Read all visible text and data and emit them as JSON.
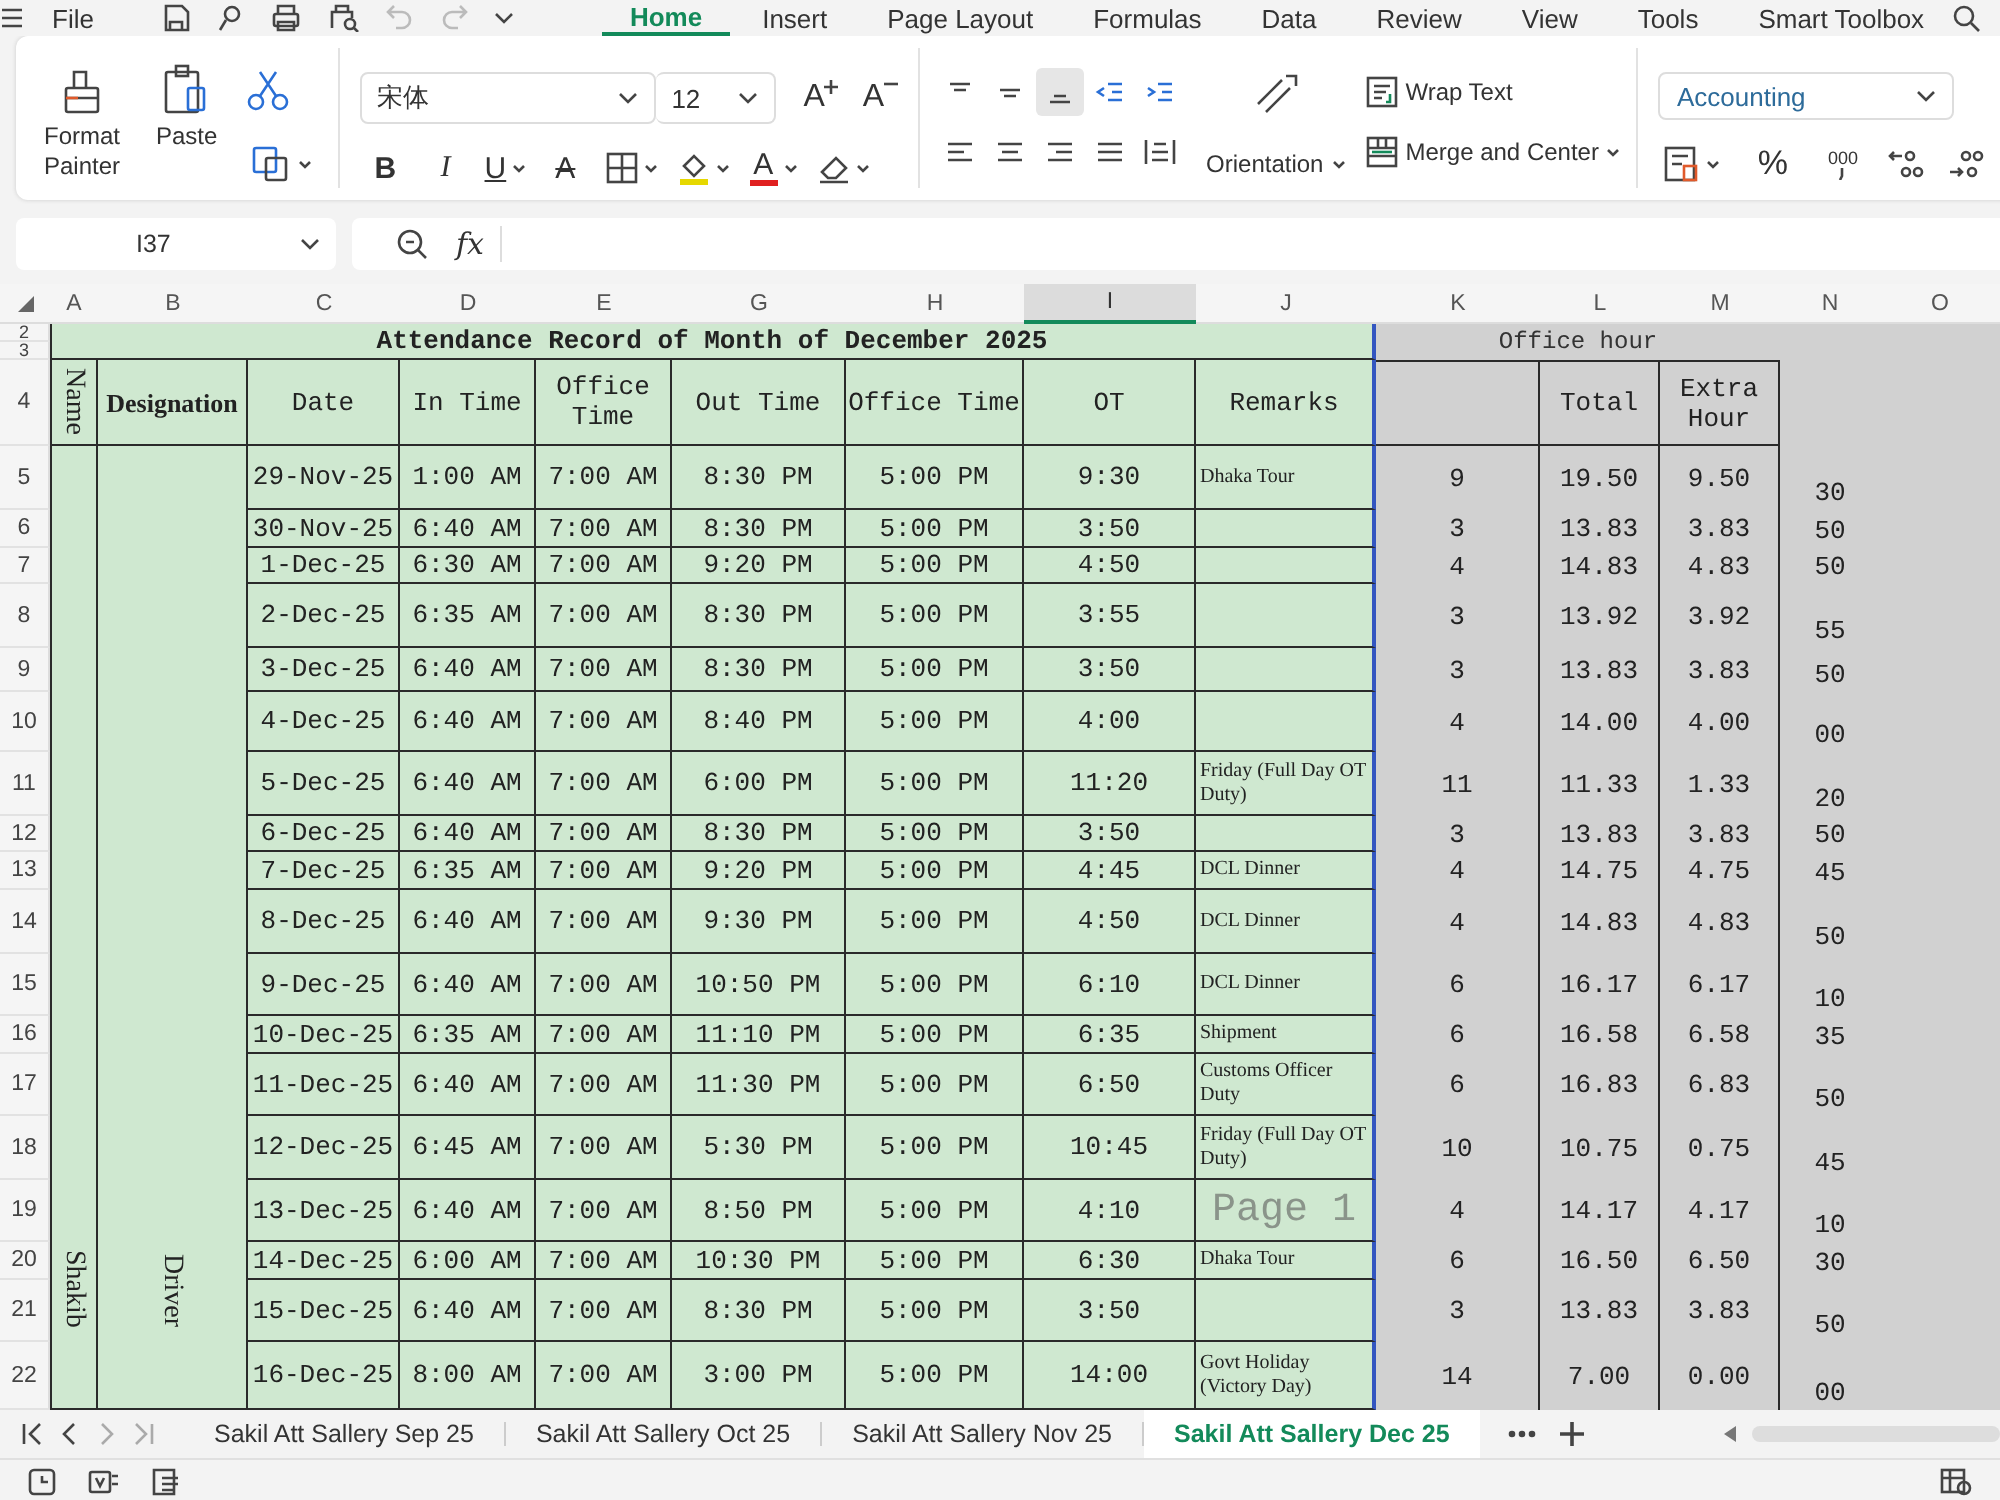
{
  "menu_bar": {
    "file": "File",
    "tabs": [
      {
        "label": "Home",
        "selected": true
      },
      {
        "label": "Insert",
        "selected": false
      },
      {
        "label": "Page Layout",
        "selected": false
      },
      {
        "label": "Formulas",
        "selected": false
      },
      {
        "label": "Data",
        "selected": false
      },
      {
        "label": "Review",
        "selected": false
      },
      {
        "label": "View",
        "selected": false
      },
      {
        "label": "Tools",
        "selected": false
      },
      {
        "label": "Smart Toolbox",
        "selected": false
      }
    ]
  },
  "ribbon": {
    "format_painter": "Format Painter",
    "paste": "Paste",
    "font_name": "宋体",
    "font_size": "12",
    "grow_font": "A",
    "shrink_font": "A",
    "text_buttons": [
      {
        "kind": "bold",
        "label": "B"
      },
      {
        "kind": "italic",
        "label": "I"
      },
      {
        "kind": "underline",
        "label": "U"
      },
      {
        "kind": "strikethrough",
        "label": "A"
      }
    ],
    "font_color": "A",
    "alignment_buttons": [
      {
        "kind": "top",
        "selected": false
      },
      {
        "kind": "middle",
        "selected": false
      },
      {
        "kind": "bottom",
        "selected": true
      },
      {
        "kind": "outdent",
        "selected": false
      },
      {
        "kind": "indent",
        "selected": false
      },
      {
        "kind": "left",
        "selected": false
      },
      {
        "kind": "center",
        "selected": false
      },
      {
        "kind": "right",
        "selected": false
      },
      {
        "kind": "justify",
        "selected": false
      },
      {
        "kind": "distributed",
        "selected": false
      }
    ],
    "orientation": "Orientation",
    "wrap_text": "Wrap Text",
    "merge_center": "Merge and Center",
    "number_format": "Accounting",
    "percent_style": "%",
    "comma_style": "000"
  },
  "formula_bar": {
    "cell_reference": "I37",
    "function_label": "fx"
  },
  "sheet": {
    "column_headers": [
      {
        "label": "A",
        "selected": false
      },
      {
        "label": "B",
        "selected": false
      },
      {
        "label": "C",
        "selected": false
      },
      {
        "label": "D",
        "selected": false
      },
      {
        "label": "E",
        "selected": false
      },
      {
        "label": "G",
        "selected": false
      },
      {
        "label": "H",
        "selected": false
      },
      {
        "label": "I",
        "selected": true
      },
      {
        "label": "J",
        "selected": false
      },
      {
        "label": "K",
        "selected": false
      },
      {
        "label": "L",
        "selected": false
      },
      {
        "label": "M",
        "selected": false
      },
      {
        "label": "N",
        "selected": false
      },
      {
        "label": "O",
        "selected": false
      }
    ],
    "header_row_numbers": [
      "2",
      "3",
      "4"
    ],
    "title": "Attendance Record of Month of  December 2025",
    "office_hour_title": "Office hour",
    "headers": [
      "Name",
      "Designation",
      "Date",
      "In Time",
      "Office Time",
      "Out Time",
      "Office Time",
      "OT",
      "Remarks"
    ],
    "summary_headers": [
      "Total",
      "Extra Hour"
    ],
    "name": "Shakib",
    "designation": "Driver",
    "rows": [
      {
        "row": "5",
        "date": "29-Nov-25",
        "in_time": "1:00 AM",
        "office_start": "7:00 AM",
        "out_time": "8:30 PM",
        "office_time": "5:00 PM",
        "ot": "9:30",
        "remarks": "Dhaka Tour",
        "column_k": "9",
        "total": "19.50",
        "extra_hour": "9.50",
        "column_n": "30"
      },
      {
        "row": "6",
        "date": "30-Nov-25",
        "in_time": "6:40 AM",
        "office_start": "7:00 AM",
        "out_time": "8:30 PM",
        "office_time": "5:00 PM",
        "ot": "3:50",
        "column_k": "3",
        "total": "13.83",
        "extra_hour": "3.83",
        "column_n": "50"
      },
      {
        "row": "7",
        "date": "1-Dec-25",
        "in_time": "6:30 AM",
        "office_start": "7:00 AM",
        "out_time": "9:20 PM",
        "office_time": "5:00 PM",
        "ot": "4:50",
        "column_k": "4",
        "total": "14.83",
        "extra_hour": "4.83",
        "column_n": "50"
      },
      {
        "row": "8",
        "date": "2-Dec-25",
        "in_time": "6:35 AM",
        "office_start": "7:00 AM",
        "out_time": "8:30 PM",
        "office_time": "5:00 PM",
        "ot": "3:55",
        "column_k": "3",
        "total": "13.92",
        "extra_hour": "3.92",
        "column_n": "55"
      },
      {
        "row": "9",
        "date": "3-Dec-25",
        "in_time": "6:40 AM",
        "office_start": "7:00 AM",
        "out_time": "8:30 PM",
        "office_time": "5:00 PM",
        "ot": "3:50",
        "column_k": "3",
        "total": "13.83",
        "extra_hour": "3.83",
        "column_n": "50"
      },
      {
        "row": "10",
        "date": "4-Dec-25",
        "in_time": "6:40 AM",
        "office_start": "7:00 AM",
        "out_time": "8:40 PM",
        "office_time": "5:00 PM",
        "ot": "4:00",
        "column_k": "4",
        "total": "14.00",
        "extra_hour": "4.00",
        "column_n": "00"
      },
      {
        "row": "11",
        "date": "5-Dec-25",
        "in_time": "6:40 AM",
        "office_start": "7:00 AM",
        "out_time": "6:00 PM",
        "office_time": "5:00 PM",
        "ot": "11:20",
        "remarks": "Friday (Full Day OT Duty)",
        "column_k": "11",
        "total": "11.33",
        "extra_hour": "1.33",
        "column_n": "20"
      },
      {
        "row": "12",
        "date": "6-Dec-25",
        "in_time": "6:40 AM",
        "office_start": "7:00 AM",
        "out_time": "8:30 PM",
        "office_time": "5:00 PM",
        "ot": "3:50",
        "column_k": "3",
        "total": "13.83",
        "extra_hour": "3.83",
        "column_n": "50"
      },
      {
        "row": "13",
        "date": "7-Dec-25",
        "in_time": "6:35 AM",
        "office_start": "7:00 AM",
        "out_time": "9:20 PM",
        "office_time": "5:00 PM",
        "ot": "4:45",
        "remarks": "DCL Dinner",
        "column_k": "4",
        "total": "14.75",
        "extra_hour": "4.75",
        "column_n": "45"
      },
      {
        "row": "14",
        "date": "8-Dec-25",
        "in_time": "6:40 AM",
        "office_start": "7:00 AM",
        "out_time": "9:30 PM",
        "office_time": "5:00 PM",
        "ot": "4:50",
        "remarks": "DCL Dinner",
        "column_k": "4",
        "total": "14.83",
        "extra_hour": "4.83",
        "column_n": "50"
      },
      {
        "row": "15",
        "date": "9-Dec-25",
        "in_time": "6:40 AM",
        "office_start": "7:00 AM",
        "out_time": "10:50 PM",
        "office_time": "5:00 PM",
        "ot": "6:10",
        "remarks": "DCL Dinner",
        "column_k": "6",
        "total": "16.17",
        "extra_hour": "6.17",
        "column_n": "10"
      },
      {
        "row": "16",
        "date": "10-Dec-25",
        "in_time": "6:35 AM",
        "office_start": "7:00 AM",
        "out_time": "11:10 PM",
        "office_time": "5:00 PM",
        "ot": "6:35",
        "remarks": "Shipment",
        "column_k": "6",
        "total": "16.58",
        "extra_hour": "6.58",
        "column_n": "35"
      },
      {
        "row": "17",
        "date": "11-Dec-25",
        "in_time": "6:40 AM",
        "office_start": "7:00 AM",
        "out_time": "11:30 PM",
        "office_time": "5:00 PM",
        "ot": "6:50",
        "remarks": "Customs Officer Duty",
        "column_k": "6",
        "total": "16.83",
        "extra_hour": "6.83",
        "column_n": "50"
      },
      {
        "row": "18",
        "date": "12-Dec-25",
        "in_time": "6:45 AM",
        "office_start": "7:00 AM",
        "out_time": "5:30 PM",
        "office_time": "5:00 PM",
        "ot": "10:45",
        "remarks": "Friday (Full Day OT Duty)",
        "column_k": "10",
        "total": "10.75",
        "extra_hour": "0.75",
        "column_n": "45"
      },
      {
        "row": "19",
        "date": "13-Dec-25",
        "in_time": "6:40 AM",
        "office_start": "7:00 AM",
        "out_time": "8:50 PM",
        "office_time": "5:00 PM",
        "ot": "4:10",
        "page_label": "Page 1",
        "column_k": "4",
        "total": "14.17",
        "extra_hour": "4.17",
        "column_n": "10"
      },
      {
        "row": "20",
        "date": "14-Dec-25",
        "in_time": "6:00 AM",
        "office_start": "7:00 AM",
        "out_time": "10:30 PM",
        "office_time": "5:00 PM",
        "ot": "6:30",
        "remarks": "Dhaka Tour",
        "column_k": "6",
        "total": "16.50",
        "extra_hour": "6.50",
        "column_n": "30"
      },
      {
        "row": "21",
        "date": "15-Dec-25",
        "in_time": "6:40 AM",
        "office_start": "7:00 AM",
        "out_time": "8:30 PM",
        "office_time": "5:00 PM",
        "ot": "3:50",
        "column_k": "3",
        "total": "13.83",
        "extra_hour": "3.83",
        "column_n": "50"
      },
      {
        "row": "22",
        "date": "16-Dec-25",
        "in_time": "8:00 AM",
        "office_start": "7:00 AM",
        "out_time": "3:00 PM",
        "office_time": "5:00 PM",
        "ot": "14:00",
        "remarks": "Govt Holiday (Victory Day)",
        "column_k": "14",
        "total": "7.00",
        "extra_hour": "0.00",
        "column_n": "00"
      }
    ]
  },
  "sheet_tabs": [
    {
      "label": "Sakil Att Sallery Sep 25",
      "selected": false
    },
    {
      "label": "Sakil Att Sallery Oct 25",
      "selected": false
    },
    {
      "label": "Sakil Att Sallery Nov 25",
      "selected": false
    },
    {
      "label": "Sakil Att Sallery Dec 25",
      "selected": true
    }
  ]
}
